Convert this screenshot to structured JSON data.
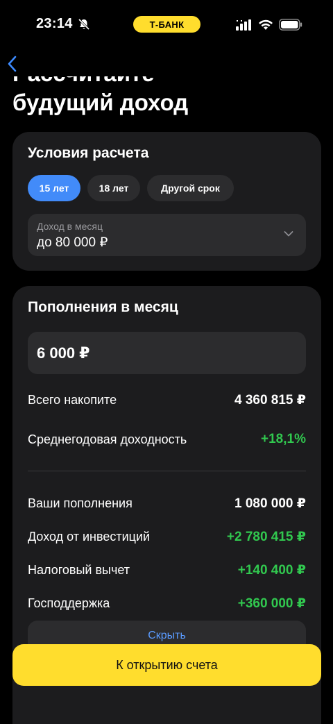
{
  "status_bar": {
    "time": "23:14",
    "bank_label": "Т-БАНК",
    "accent_color": "#ffdd2d"
  },
  "header": {
    "back_icon": "chevron-left-icon",
    "title_partial": "Рассчитайте",
    "title": "будущий доход"
  },
  "conditions": {
    "title": "Условия расчета",
    "terms": [
      {
        "label": "15 лет",
        "active": true
      },
      {
        "label": "18 лет",
        "active": false
      },
      {
        "label": "Другой срок",
        "active": false
      }
    ],
    "income": {
      "label": "Доход в месяц",
      "value": "до 80 000 ₽"
    }
  },
  "deposits": {
    "title": "Пополнения в месяц",
    "amount": "6 000 ₽",
    "summary": [
      {
        "label": "Всего накопите",
        "value": "4 360 815 ₽",
        "positive": false
      },
      {
        "label": "Среднегодовая доходность",
        "value": "+18,1%",
        "positive": true
      }
    ],
    "details": [
      {
        "label": "Ваши пополнения",
        "value": "1 080 000 ₽",
        "positive": false
      },
      {
        "label": "Доход от инвестиций",
        "value": "+2 780 415 ₽",
        "positive": true
      },
      {
        "label": "Налоговый вычет",
        "value": "+140 400 ₽",
        "positive": true
      },
      {
        "label": "Господдержка",
        "value": "+360 000 ₽",
        "positive": true
      }
    ],
    "hide_label": "Скрыть"
  },
  "cta": {
    "label": "К открытию счета"
  },
  "colors": {
    "active_chip": "#428bf9",
    "positive": "#31c84f",
    "card": "#1c1c1e"
  }
}
